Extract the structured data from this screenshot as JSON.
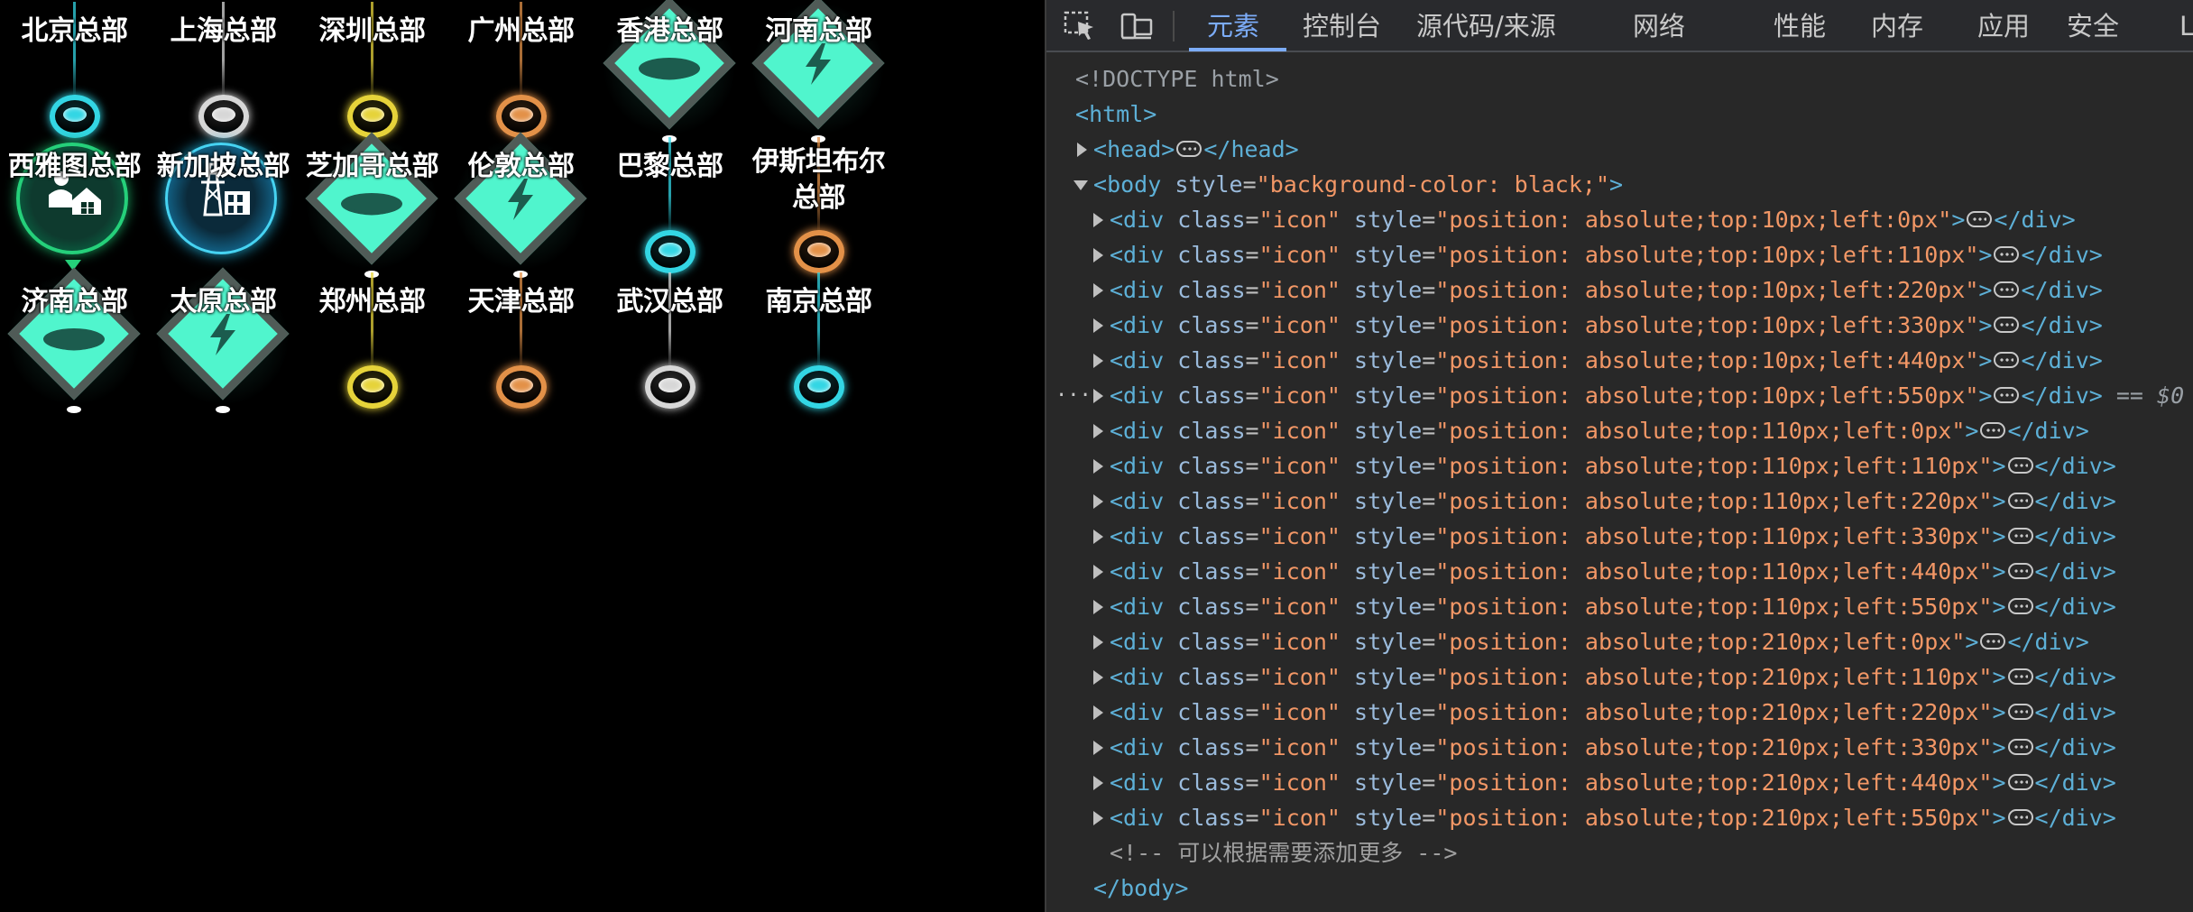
{
  "page": {
    "icons": [
      {
        "label": "北京总部",
        "kind": "beacon",
        "color": "#33d6e4"
      },
      {
        "label": "上海总部",
        "kind": "beacon",
        "color": "#d7d7d7"
      },
      {
        "label": "深圳总部",
        "kind": "beacon",
        "color": "#e6d33a"
      },
      {
        "label": "广州总部",
        "kind": "beacon",
        "color": "#e39148"
      },
      {
        "label": "香港总部",
        "kind": "diamond",
        "glyph": "platform-icon"
      },
      {
        "label": "河南总部",
        "kind": "diamond",
        "glyph": "lightning-icon"
      },
      {
        "label": "西雅图总部",
        "kind": "circle-green",
        "glyph": "people-house-icon"
      },
      {
        "label": "新加坡总部",
        "kind": "circle-blue",
        "glyph": "power-tower-icon"
      },
      {
        "label": "芝加哥总部",
        "kind": "diamond",
        "glyph": "platform-icon"
      },
      {
        "label": "伦敦总部",
        "kind": "diamond",
        "glyph": "lightning-icon"
      },
      {
        "label": "巴黎总部",
        "kind": "beacon",
        "color": "#33d6e4"
      },
      {
        "label": "伊斯坦布尔总部",
        "kind": "beacon",
        "color": "#e39148"
      },
      {
        "label": "济南总部",
        "kind": "diamond",
        "glyph": "platform-icon"
      },
      {
        "label": "太原总部",
        "kind": "diamond",
        "glyph": "lightning-icon"
      },
      {
        "label": "郑州总部",
        "kind": "beacon",
        "color": "#e6d33a"
      },
      {
        "label": "天津总部",
        "kind": "beacon",
        "color": "#e39148"
      },
      {
        "label": "武汉总部",
        "kind": "beacon",
        "color": "#d7d7d7"
      },
      {
        "label": "南京总部",
        "kind": "beacon",
        "color": "#33d6e4"
      }
    ]
  },
  "devtools": {
    "tabs": [
      "元素",
      "控制台",
      "源代码/来源",
      "网络",
      "性能",
      "内存",
      "应用",
      "安全",
      "Lighthouse"
    ],
    "active_tab": "元素",
    "lines": [
      {
        "kind": "doctype",
        "text": "<!DOCTYPE html>"
      },
      {
        "kind": "open",
        "tag": "html"
      },
      {
        "kind": "collapsed",
        "tag": "head"
      },
      {
        "kind": "body",
        "tag": "body",
        "attr": "style",
        "value": "background-color: black;"
      },
      {
        "kind": "div",
        "cls": "icon",
        "style": "position: absolute;top:10px;left:0px"
      },
      {
        "kind": "div",
        "cls": "icon",
        "style": "position: absolute;top:10px;left:110px"
      },
      {
        "kind": "div",
        "cls": "icon",
        "style": "position: absolute;top:10px;left:220px"
      },
      {
        "kind": "div",
        "cls": "icon",
        "style": "position: absolute;top:10px;left:330px"
      },
      {
        "kind": "div",
        "cls": "icon",
        "style": "position: absolute;top:10px;left:440px"
      },
      {
        "kind": "div",
        "cls": "icon",
        "style": "position: absolute;top:10px;left:550px",
        "selected": true
      },
      {
        "kind": "div",
        "cls": "icon",
        "style": "position: absolute;top:110px;left:0px"
      },
      {
        "kind": "div",
        "cls": "icon",
        "style": "position: absolute;top:110px;left:110px"
      },
      {
        "kind": "div",
        "cls": "icon",
        "style": "position: absolute;top:110px;left:220px"
      },
      {
        "kind": "div",
        "cls": "icon",
        "style": "position: absolute;top:110px;left:330px"
      },
      {
        "kind": "div",
        "cls": "icon",
        "style": "position: absolute;top:110px;left:440px"
      },
      {
        "kind": "div",
        "cls": "icon",
        "style": "position: absolute;top:110px;left:550px"
      },
      {
        "kind": "div",
        "cls": "icon",
        "style": "position: absolute;top:210px;left:0px"
      },
      {
        "kind": "div",
        "cls": "icon",
        "style": "position: absolute;top:210px;left:110px"
      },
      {
        "kind": "div",
        "cls": "icon",
        "style": "position: absolute;top:210px;left:220px"
      },
      {
        "kind": "div",
        "cls": "icon",
        "style": "position: absolute;top:210px;left:330px"
      },
      {
        "kind": "div",
        "cls": "icon",
        "style": "position: absolute;top:210px;left:440px"
      },
      {
        "kind": "div",
        "cls": "icon",
        "style": "position: absolute;top:210px;left:550px"
      },
      {
        "kind": "comment",
        "text": "<!-- 可以根据需要添加更多 -->"
      },
      {
        "kind": "close",
        "tag": "body"
      }
    ],
    "selected_marker": "== $0"
  },
  "colors": {
    "diamond_fill": "#50f5cd",
    "diamond_border": "#505b57",
    "tab_active": "#7cacf8"
  }
}
